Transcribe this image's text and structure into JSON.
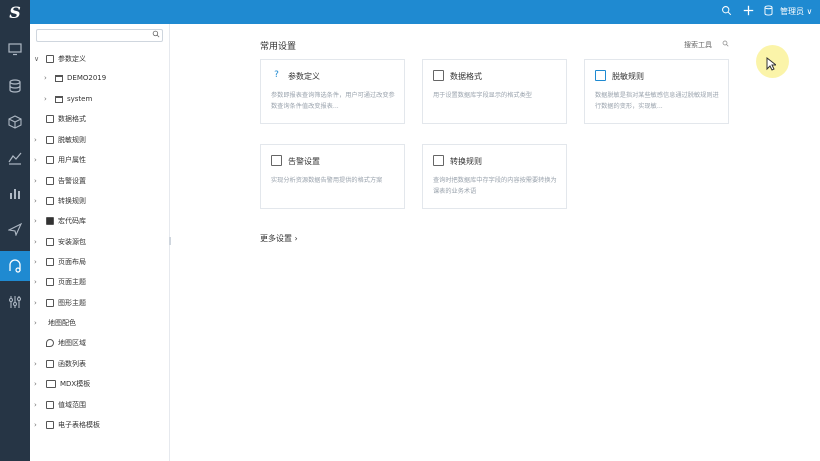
{
  "topbar": {
    "search_icon": "search-icon",
    "add_icon": "plus-icon",
    "db_icon": "database-icon",
    "user_label": "管理员 ∨",
    "bg": "#1f8ad1"
  },
  "rail": {
    "logo": "S",
    "items": [
      "monitor-icon",
      "database-icon",
      "cube-icon",
      "layers-icon",
      "bar-chart-icon",
      "send-icon",
      "tools-icon",
      "settings-tools-icon"
    ],
    "active_index": 6,
    "bg": "#263545"
  },
  "tree": {
    "search_placeholder": "",
    "items": [
      {
        "arrow": "∨",
        "label": "参数定义"
      },
      {
        "arrow": "›",
        "label": "DEMO2019"
      },
      {
        "arrow": "›",
        "label": "system"
      },
      {
        "arrow": "",
        "label": "数据格式"
      },
      {
        "arrow": "›",
        "label": "脱敏规则"
      },
      {
        "arrow": "›",
        "label": "用户属性"
      },
      {
        "arrow": "›",
        "label": "告警设置"
      },
      {
        "arrow": "›",
        "label": "转换规则"
      },
      {
        "arrow": "›",
        "label": "宏代码库"
      },
      {
        "arrow": "›",
        "label": "安装源包"
      },
      {
        "arrow": "›",
        "label": "页面布局"
      },
      {
        "arrow": "›",
        "label": "页面主题"
      },
      {
        "arrow": "›",
        "label": "图形主题"
      },
      {
        "arrow": "›",
        "label": "地图配色"
      },
      {
        "arrow": "",
        "label": "地图区域"
      },
      {
        "arrow": "›",
        "label": "函数列表"
      },
      {
        "arrow": "›",
        "label": "MDX模板"
      },
      {
        "arrow": "›",
        "label": "值域范围"
      },
      {
        "arrow": "›",
        "label": "电子表格模板"
      }
    ]
  },
  "main": {
    "section_title": "常用设置",
    "search_tools": "搜索工具",
    "cards": [
      {
        "title": "参数定义",
        "desc": "参数即报表查询筛选条件，用户可通过改变参数查询条件值改变报表..."
      },
      {
        "title": "数据格式",
        "desc": "用于设置数据库字段显示的格式类型"
      },
      {
        "title": "脱敏规则",
        "desc": "数据脱敏是指对某些敏感信息通过脱敏规则进行数据的变形，实现敏..."
      },
      {
        "title": "告警设置",
        "desc": "实现分析资源数据告警用提供的格式方案"
      },
      {
        "title": "转换规则",
        "desc": "查询时把数据库中存字段的内容按需要转换为课表的业务术语"
      }
    ],
    "more_label": "更多设置 ›"
  }
}
